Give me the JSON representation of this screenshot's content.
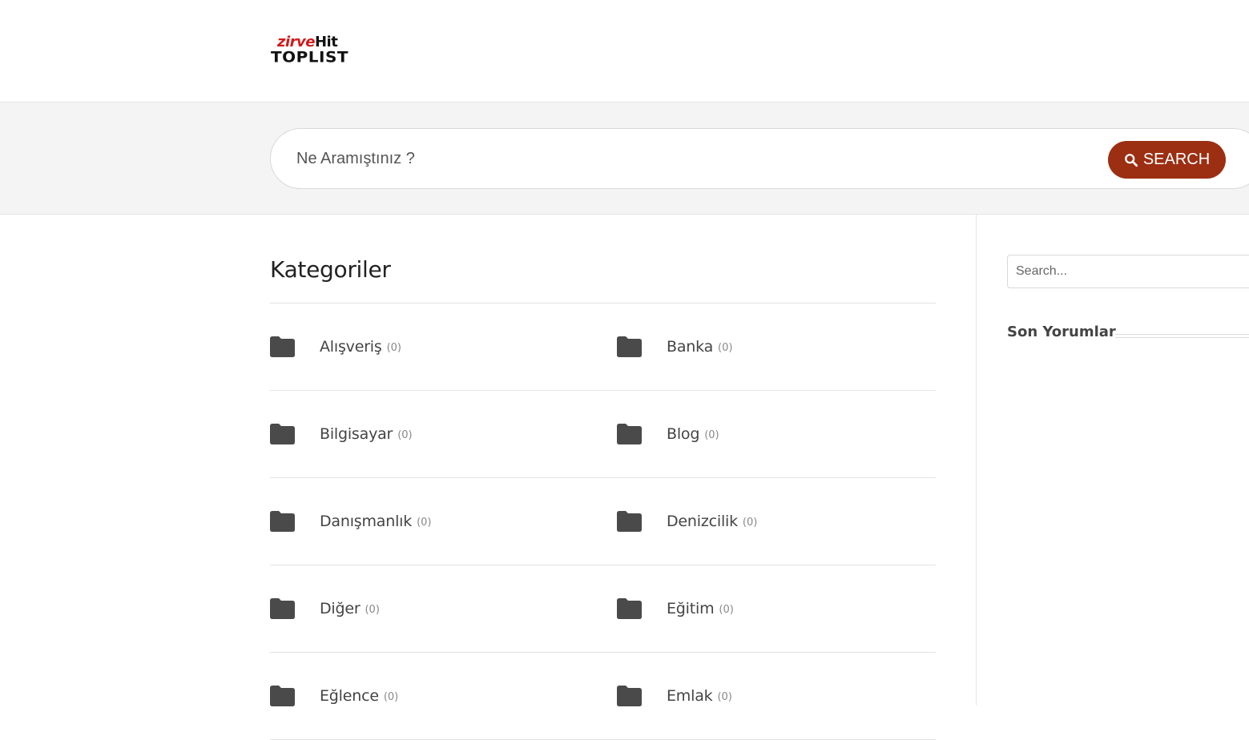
{
  "header": {
    "logo": {
      "line1_a": "zirve",
      "line1_b": "Hit",
      "line2": "TOPLIST"
    }
  },
  "hero_search": {
    "placeholder": "Ne Aramıştınız ?",
    "button_label": "SEARCH"
  },
  "main": {
    "title": "Kategoriler",
    "categories": [
      {
        "name": "Alışveriş",
        "count": "(0)"
      },
      {
        "name": "Banka",
        "count": "(0)"
      },
      {
        "name": "Bilgisayar",
        "count": "(0)"
      },
      {
        "name": "Blog",
        "count": "(0)"
      },
      {
        "name": "Danışmanlık",
        "count": "(0)"
      },
      {
        "name": "Denizcilik",
        "count": "(0)"
      },
      {
        "name": "Diğer",
        "count": "(0)"
      },
      {
        "name": "Eğitim",
        "count": "(0)"
      },
      {
        "name": "Eğlence",
        "count": "(0)"
      },
      {
        "name": "Emlak",
        "count": "(0)"
      }
    ]
  },
  "sidebar": {
    "search_placeholder": "Search...",
    "widget_title": "Son Yorumlar"
  },
  "icons": {
    "category": "folder-icon",
    "search": "search-icon"
  },
  "colors": {
    "accent": "#9c2e12",
    "logo_red": "#d11b1b",
    "folder": "#4a4a4a"
  }
}
